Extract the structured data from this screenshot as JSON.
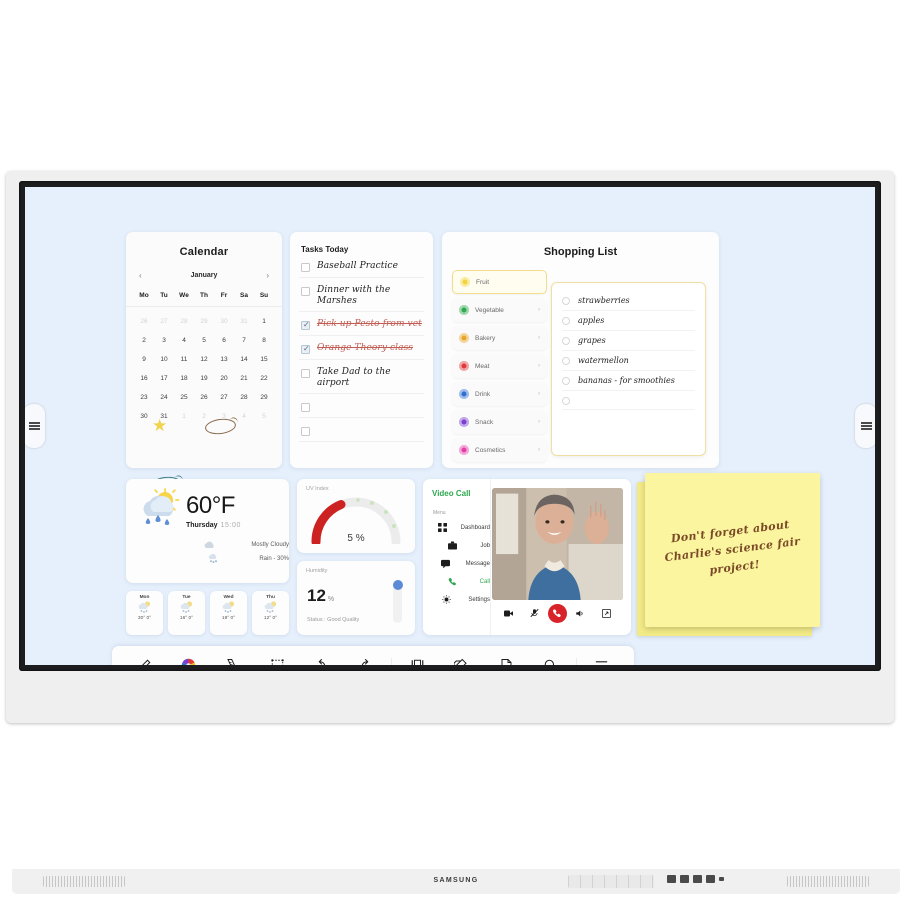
{
  "device": {
    "brand": "SAMSUNG"
  },
  "calendar": {
    "title": "Calendar",
    "month": "January",
    "prev_label": "‹",
    "next_label": "›",
    "dow": [
      "Mo",
      "Tu",
      "We",
      "Th",
      "Fr",
      "Sa",
      "Su"
    ],
    "cells": [
      {
        "d": "26",
        "mut": true
      },
      {
        "d": "27",
        "mut": true
      },
      {
        "d": "28",
        "mut": true
      },
      {
        "d": "29",
        "mut": true
      },
      {
        "d": "30",
        "mut": true
      },
      {
        "d": "31",
        "mut": true
      },
      {
        "d": "1",
        "mut": false
      },
      {
        "d": "2",
        "mut": false
      },
      {
        "d": "3",
        "mut": false
      },
      {
        "d": "4",
        "mut": false
      },
      {
        "d": "5",
        "mut": false
      },
      {
        "d": "6",
        "mut": false
      },
      {
        "d": "7",
        "mut": false
      },
      {
        "d": "8",
        "mut": false
      },
      {
        "d": "9",
        "mut": false
      },
      {
        "d": "10",
        "mut": false
      },
      {
        "d": "11",
        "mut": false
      },
      {
        "d": "12",
        "mut": false
      },
      {
        "d": "13",
        "mut": false
      },
      {
        "d": "14",
        "mut": false
      },
      {
        "d": "15",
        "mut": false
      },
      {
        "d": "16",
        "mut": false
      },
      {
        "d": "17",
        "mut": false
      },
      {
        "d": "18",
        "mut": false
      },
      {
        "d": "19",
        "mut": false
      },
      {
        "d": "20",
        "mut": false
      },
      {
        "d": "21",
        "mut": false
      },
      {
        "d": "22",
        "mut": false
      },
      {
        "d": "23",
        "mut": false
      },
      {
        "d": "24",
        "mut": false
      },
      {
        "d": "25",
        "mut": false
      },
      {
        "d": "26",
        "mut": false
      },
      {
        "d": "27",
        "mut": false
      },
      {
        "d": "28",
        "mut": false
      },
      {
        "d": "29",
        "mut": false
      },
      {
        "d": "30",
        "mut": false
      },
      {
        "d": "31",
        "mut": false
      },
      {
        "d": "1",
        "mut": true
      },
      {
        "d": "2",
        "mut": true
      },
      {
        "d": "3",
        "mut": true
      },
      {
        "d": "4",
        "mut": true
      },
      {
        "d": "5",
        "mut": true
      }
    ],
    "annotations": {
      "star_on_day": "10",
      "star_color": "#f2d34e",
      "ring_brown_day": "12",
      "ring_brown_color": "#8a6a4b",
      "ring_teal_day": "24",
      "ring_teal_color": "#3f7f80"
    }
  },
  "tasks": {
    "title": "Tasks Today",
    "items": [
      {
        "text": "Baseball Practice",
        "done": false
      },
      {
        "text": "Dinner with the Marshes",
        "done": false
      },
      {
        "text": "Pick up Pesto from vet",
        "done": true
      },
      {
        "text": "Orange Theory class",
        "done": true
      },
      {
        "text": "Take Dad to the airport",
        "done": false
      },
      {
        "text": "",
        "done": false
      },
      {
        "text": "",
        "done": false
      }
    ]
  },
  "shopping": {
    "title": "Shopping List",
    "categories": [
      {
        "label": "Fruit",
        "color": "#f2d43c",
        "selected": true,
        "arrow": "›"
      },
      {
        "label": "Vegetable",
        "color": "#2fa84f",
        "selected": false,
        "arrow": "›"
      },
      {
        "label": "Bakery",
        "color": "#e8a52a",
        "selected": false,
        "arrow": "›"
      },
      {
        "label": "Meat",
        "color": "#dd3b3b",
        "selected": false,
        "arrow": "›"
      },
      {
        "label": "Drink",
        "color": "#2f6fd0",
        "selected": false,
        "arrow": "›"
      },
      {
        "label": "Snack",
        "color": "#7b3fd0",
        "selected": false,
        "arrow": "›"
      },
      {
        "label": "Cosmetics",
        "color": "#e23fa8",
        "selected": false,
        "arrow": "›"
      }
    ],
    "items": [
      {
        "text": "strawberries",
        "checked": false
      },
      {
        "text": "apples",
        "checked": false
      },
      {
        "text": "grapes",
        "checked": false
      },
      {
        "text": "watermellon",
        "checked": false
      },
      {
        "text": "bananas - for smoothies",
        "checked": false
      },
      {
        "text": "",
        "checked": false
      }
    ]
  },
  "weather": {
    "temperature": "60°F",
    "day": "Thursday",
    "time": "15:00",
    "condition": "Mostly Cloudy",
    "rain": "Rain - 30%",
    "forecast": [
      {
        "day": "Mon",
        "temp": "30° 0°"
      },
      {
        "day": "Tue",
        "temp": "16° 0°"
      },
      {
        "day": "Wed",
        "temp": "18° 0°"
      },
      {
        "day": "Thu",
        "temp": "12° 0°"
      }
    ]
  },
  "uv": {
    "title": "UV Index",
    "value": "5 %",
    "percent": 5,
    "arc_color": "#cc2222"
  },
  "humidity": {
    "title": "Humidity",
    "value": "12",
    "unit": "%",
    "status": "Status : Good Quality"
  },
  "videocall": {
    "title": "Video Call",
    "menu_label": "Menu",
    "menu": [
      {
        "label": "Dashboard",
        "icon": "grid-icon",
        "active": false
      },
      {
        "label": "Job",
        "icon": "briefcase-icon",
        "active": false
      },
      {
        "label": "Message",
        "icon": "chat-icon",
        "active": false
      },
      {
        "label": "Call",
        "icon": "phone-icon",
        "active": true
      },
      {
        "label": "Settings",
        "icon": "gear-icon",
        "active": false
      }
    ],
    "controls": [
      "camera-icon",
      "mic-off-icon",
      "end-call-icon",
      "speaker-icon",
      "expand-icon"
    ],
    "accent": "#2fa84f",
    "end_call_color": "#d8232a"
  },
  "sticky": {
    "text": "Don't forget about Charlie's science fair project!",
    "color": "#fbf5a0"
  },
  "toolbar": {
    "items": [
      {
        "label": "Pen",
        "icon": "pen-icon"
      },
      {
        "label": "Palette",
        "icon": "palette-icon"
      },
      {
        "label": "Math Tools",
        "icon": "ruler-icon"
      },
      {
        "label": "Select",
        "icon": "select-icon"
      },
      {
        "label": "Undo",
        "icon": "undo-icon"
      },
      {
        "label": "Redo",
        "icon": "redo-icon"
      },
      {
        "label": "Pages",
        "icon": "pages-icon"
      },
      {
        "label": "Note On",
        "icon": "note-icon"
      },
      {
        "label": "Miniboard",
        "icon": "miniboard-icon"
      },
      {
        "label": "Search",
        "icon": "search-icon"
      },
      {
        "label": "Menu",
        "icon": "hamburger-icon"
      }
    ]
  },
  "theme": {
    "screen_bg": "#e6f0fc",
    "card_bg": "#fdfdfd"
  }
}
